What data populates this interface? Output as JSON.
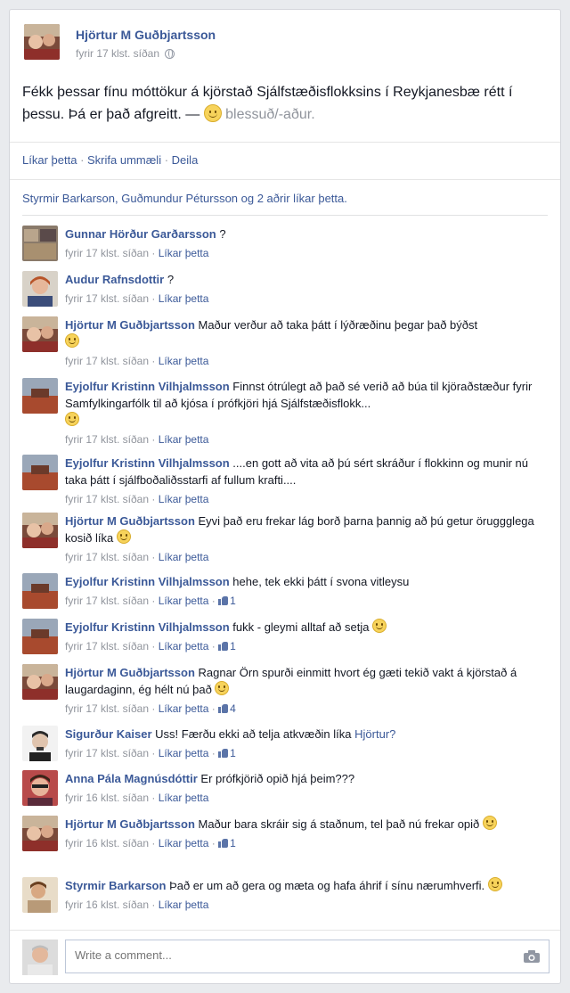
{
  "post": {
    "author": "Hjörtur M Guðbjartsson",
    "time": "fyrir 17 klst. síðan",
    "text": "Fékk þessar fínu móttökur á kjörstað Sjálfstæðisflokksins í Reykjanesbæ rétt í þessu. Þá er það afgreitt. —",
    "feeling": "blessuð/-aður."
  },
  "actions": {
    "like": "Líkar þetta",
    "comment": "Skrifa ummæli",
    "share": "Deila"
  },
  "likes_summary": "Styrmir Barkarson, Guðmundur Pétursson og 2 aðrir líkar þetta.",
  "comments": [
    {
      "name": "Gunnar Hörður Garðarsson",
      "text": " ?",
      "time": "fyrir 17 klst. síðan",
      "like": "Líkar þetta",
      "likes": ""
    },
    {
      "name": "Audur Rafnsdottir",
      "text": " ?",
      "time": "fyrir 17 klst. síðan",
      "like": "Líkar þetta",
      "likes": ""
    },
    {
      "name": "Hjörtur M Guðbjartsson",
      "text": " Maður verður að taka þátt í lýðræðinu þegar það býðst",
      "time": "fyrir 17 klst. síðan",
      "like": "Líkar þetta",
      "likes": ""
    },
    {
      "name": "Eyjolfur Kristinn Vilhjalmsson",
      "text": " Finnst ótrúlegt að það sé verið að búa til kjöraðstæður fyrir Samfylkingarfólk til að kjósa í prófkjöri hjá Sjálfstæðisflokk...",
      "time": "fyrir 17 klst. síðan",
      "like": "Líkar þetta",
      "likes": ""
    },
    {
      "name": "Eyjolfur Kristinn Vilhjalmsson",
      "text": " ....en gott að vita að þú sért skráður í flokkinn og munir nú taka þátt í sjálfboðaliðsstarfi af fullum krafti....",
      "time": "fyrir 17 klst. síðan",
      "like": "Líkar þetta",
      "likes": ""
    },
    {
      "name": "Hjörtur M Guðbjartsson",
      "text": " Eyvi það eru frekar lág borð þarna þannig að þú getur öruggglega kosið líka",
      "time": "fyrir 17 klst. síðan",
      "like": "Líkar þetta",
      "likes": ""
    },
    {
      "name": "Eyjolfur Kristinn Vilhjalmsson",
      "text": " hehe, tek ekki þátt í svona vitleysu",
      "time": "fyrir 17 klst. síðan",
      "like": "Líkar þetta",
      "likes": "1"
    },
    {
      "name": "Eyjolfur Kristinn Vilhjalmsson",
      "text": " fukk - gleymi alltaf að setja",
      "time": "fyrir 17 klst. síðan",
      "like": "Líkar þetta",
      "likes": "1"
    },
    {
      "name": "Hjörtur M Guðbjartsson",
      "text": " Ragnar Örn spurði einmitt hvort ég gæti tekið vakt á kjörstað á laugardaginn, ég hélt nú það",
      "time": "fyrir 17 klst. síðan",
      "like": "Líkar þetta",
      "likes": "4"
    },
    {
      "name": "Sigurður Kaiser",
      "text": " Uss! Færðu ekki að telja atkvæðin líka",
      "mention": "Hjörtur?",
      "time": "fyrir 17 klst. síðan",
      "like": "Líkar þetta",
      "likes": "1"
    },
    {
      "name": "Anna Pála Magnúsdóttir",
      "text": " Er prófkjörið opið hjá þeim???",
      "time": "fyrir 16 klst. síðan",
      "like": "Líkar þetta",
      "likes": ""
    },
    {
      "name": "Hjörtur M Guðbjartsson",
      "text": " Maður bara skráir sig á staðnum, tel það nú frekar opið",
      "time": "fyrir 16 klst. síðan",
      "like": "Líkar þetta",
      "likes": "1"
    },
    {
      "name": "Styrmir Barkarson",
      "text": " Það er um að gera og mæta og hafa áhrif í sínu nærumhverfi.",
      "time": "fyrir 16 klst. síðan",
      "like": "Líkar þetta",
      "likes": ""
    }
  ],
  "composer": {
    "placeholder": "Write a comment..."
  },
  "icons": [
    "globe-icon",
    "smile-icon",
    "thumbs-up-icon",
    "camera-icon"
  ]
}
